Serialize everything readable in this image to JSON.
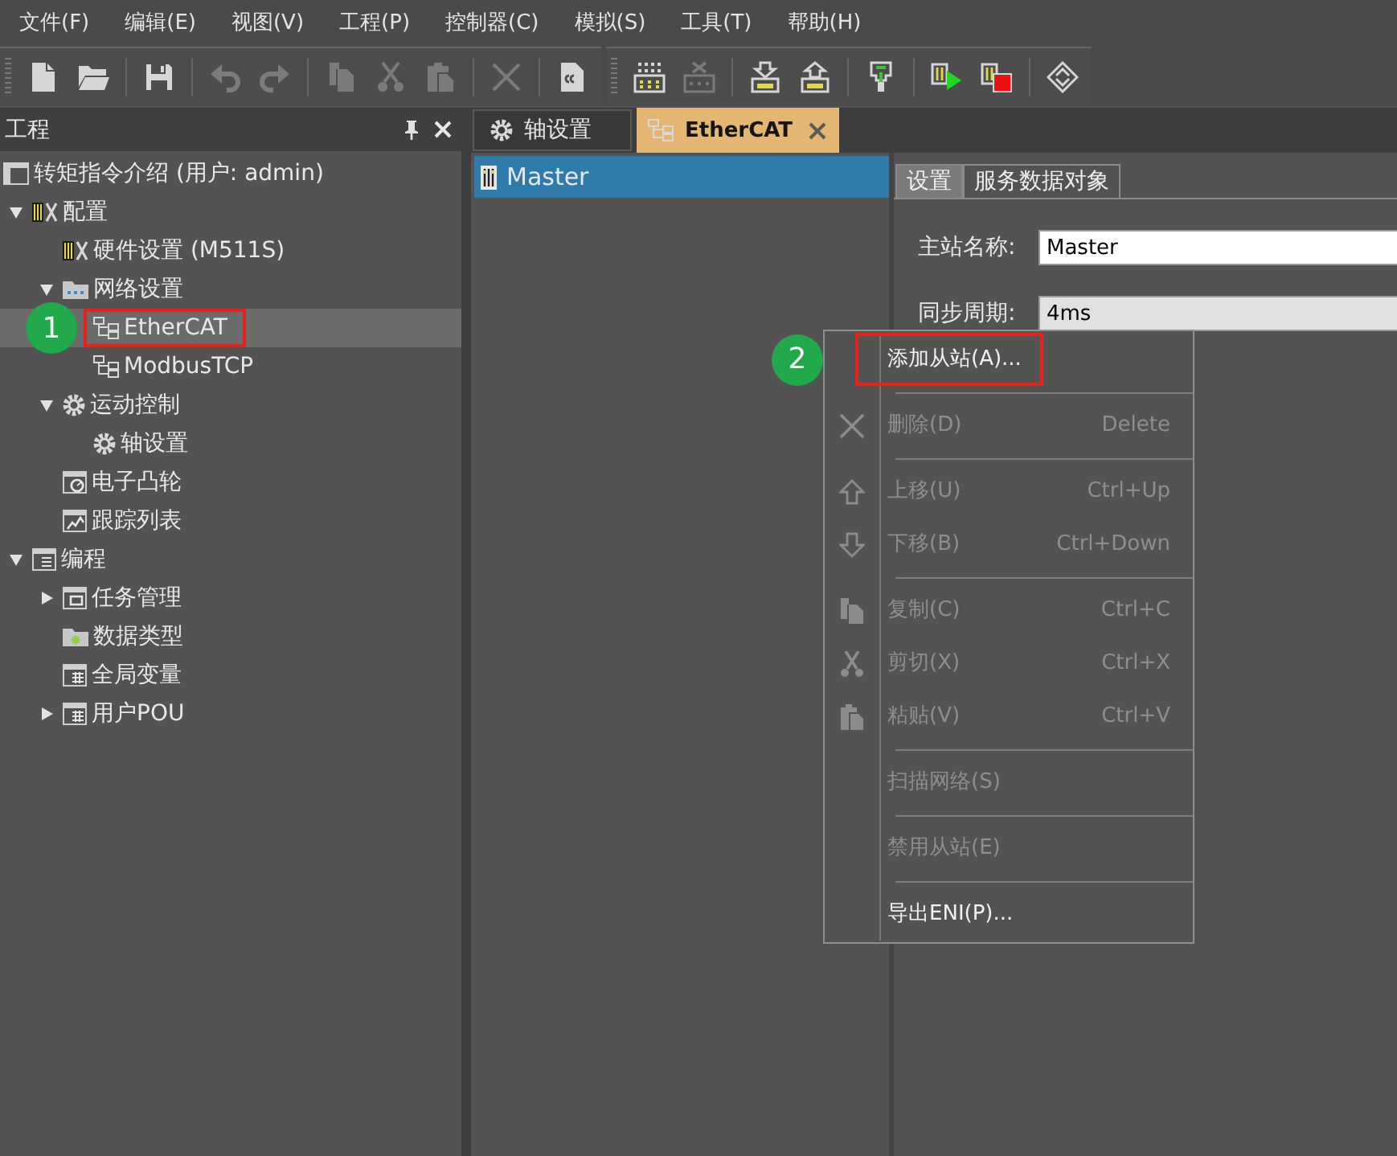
{
  "menu_bar": [
    "文件(F)",
    "编辑(E)",
    "视图(V)",
    "工程(P)",
    "控制器(C)",
    "模拟(S)",
    "工具(T)",
    "帮助(H)"
  ],
  "toolbars": [
    {
      "items": [
        {
          "kind": "new",
          "disabled": false
        },
        {
          "kind": "open",
          "disabled": false
        },
        {
          "kind": "separator"
        },
        {
          "kind": "save",
          "disabled": false
        },
        {
          "kind": "separator"
        },
        {
          "kind": "undo",
          "disabled": true
        },
        {
          "kind": "redo",
          "disabled": true
        },
        {
          "kind": "separator"
        },
        {
          "kind": "copy",
          "disabled": true
        },
        {
          "kind": "cut",
          "disabled": true
        },
        {
          "kind": "paste",
          "disabled": true
        },
        {
          "kind": "separator"
        },
        {
          "kind": "delete",
          "disabled": true
        },
        {
          "kind": "separator"
        },
        {
          "kind": "build",
          "disabled": false
        }
      ]
    },
    {
      "items": [
        {
          "kind": "scan",
          "disabled": false
        },
        {
          "kind": "devicex",
          "disabled": true
        },
        {
          "kind": "separator"
        },
        {
          "kind": "download",
          "disabled": false
        },
        {
          "kind": "upload",
          "disabled": false
        },
        {
          "kind": "separator"
        },
        {
          "kind": "plug",
          "disabled": false
        },
        {
          "kind": "separator"
        },
        {
          "kind": "run",
          "disabled": false
        },
        {
          "kind": "stop",
          "disabled": false
        },
        {
          "kind": "separator"
        },
        {
          "kind": "refresh",
          "disabled": false
        }
      ]
    }
  ],
  "project_panel": {
    "title": "工程",
    "project": "转矩指令介绍 (用户: admin)",
    "tree": [
      {
        "label": "配置",
        "kind": "module",
        "expanded": true,
        "selected": false,
        "children": [
          {
            "label": "硬件设置 (M511S)",
            "kind": "module",
            "selected": false
          },
          {
            "label": "网络设置",
            "kind": "netfolder",
            "expanded": true,
            "selected": false,
            "children": [
              {
                "label": "EtherCAT",
                "kind": "network",
                "selected": true,
                "callout": "1"
              },
              {
                "label": "ModbusTCP",
                "kind": "network",
                "selected": false
              }
            ]
          },
          {
            "label": "运动控制",
            "kind": "gear",
            "expanded": true,
            "selected": false,
            "children": [
              {
                "label": "轴设置",
                "kind": "gear",
                "selected": false
              }
            ]
          },
          {
            "label": "电子凸轮",
            "kind": "cam",
            "selected": false
          },
          {
            "label": "跟踪列表",
            "kind": "trace",
            "selected": false
          }
        ]
      },
      {
        "label": "编程",
        "kind": "program",
        "expanded": true,
        "selected": false,
        "children": [
          {
            "label": "任务管理",
            "kind": "task",
            "expanded": false,
            "selected": false
          },
          {
            "label": "数据类型",
            "kind": "datatype",
            "selected": false
          },
          {
            "label": "全局变量",
            "kind": "variables",
            "selected": false
          },
          {
            "label": "用户POU",
            "kind": "variables",
            "expanded": false,
            "selected": false
          }
        ]
      }
    ]
  },
  "document_tabs": [
    {
      "label": "轴设置",
      "kind": "gear",
      "selected": false
    },
    {
      "label": "EtherCAT",
      "kind": "network",
      "selected": true
    }
  ],
  "device_list": [
    {
      "label": "Master",
      "selected": true
    }
  ],
  "settings": {
    "tabs": [
      {
        "label": "设置",
        "selected": true
      },
      {
        "label": "服务数据对象",
        "selected": false
      }
    ],
    "fields": [
      {
        "label": "主站名称:",
        "value": "Master",
        "kind": "text"
      },
      {
        "label": "同步周期:",
        "value": "4ms",
        "kind": "dropdown"
      }
    ]
  },
  "context_menu": {
    "items": [
      {
        "kind": "plain",
        "label": "添加从站(A)...",
        "disabled": false,
        "callout": "2"
      },
      {
        "kind": "separator"
      },
      {
        "kind": "delete",
        "label": "删除(D)",
        "shortcut": "Delete",
        "disabled": true
      },
      {
        "kind": "separator"
      },
      {
        "kind": "up",
        "label": "上移(U)",
        "shortcut": "Ctrl+Up",
        "disabled": true
      },
      {
        "kind": "down",
        "label": "下移(B)",
        "shortcut": "Ctrl+Down",
        "disabled": true
      },
      {
        "kind": "separator"
      },
      {
        "kind": "copy",
        "label": "复制(C)",
        "shortcut": "Ctrl+C",
        "disabled": true
      },
      {
        "kind": "cut",
        "label": "剪切(X)",
        "shortcut": "Ctrl+X",
        "disabled": true
      },
      {
        "kind": "paste",
        "label": "粘贴(V)",
        "shortcut": "Ctrl+V",
        "disabled": true
      },
      {
        "kind": "separator"
      },
      {
        "kind": "plain",
        "label": "扫描网络(S)",
        "disabled": true
      },
      {
        "kind": "separator"
      },
      {
        "kind": "plain",
        "label": "禁用从站(E)",
        "disabled": true
      },
      {
        "kind": "separator"
      },
      {
        "kind": "plain",
        "label": "导出ENI(P)...",
        "disabled": false
      }
    ]
  }
}
